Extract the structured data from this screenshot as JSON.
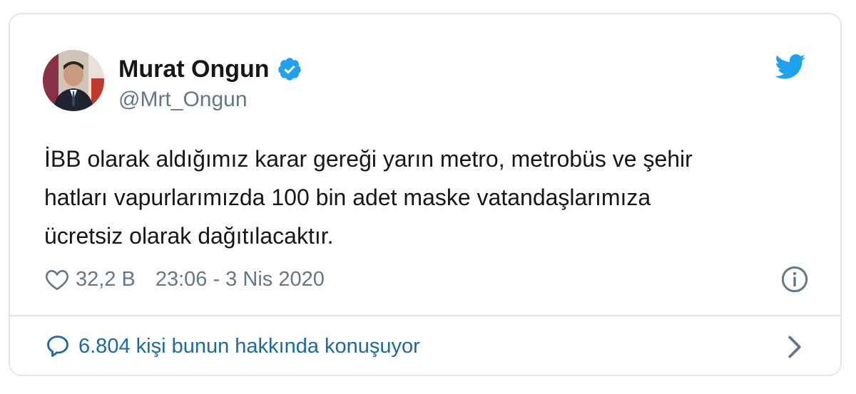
{
  "user": {
    "name": "Murat Ongun",
    "handle": "@Mrt_Ongun",
    "verified": true
  },
  "tweet": {
    "lines": [
      "İBB olarak aldığımız karar gereği yarın metro, metrobüs ve şehir",
      "hatları vapurlarımızda 100 bin adet maske vatandaşlarımıza",
      "ücretsiz olarak dağıtılacaktır."
    ]
  },
  "meta": {
    "likes": "32,2 B",
    "timestamp": "23:06 - 3 Nis 2020"
  },
  "footer": {
    "conversation_text": "6.804 kişi bunun hakkında konuşuyor"
  },
  "icons": {
    "brand": "twitter-bird-icon",
    "verified": "verified-badge-icon",
    "like": "heart-icon",
    "info": "info-icon",
    "reply": "reply-bubble-icon",
    "chevron": "chevron-right-icon"
  },
  "colors": {
    "twitter_blue": "#1da1f2",
    "link_blue": "#1b6aa5",
    "text": "#14171a",
    "secondary": "#657786",
    "border": "#e1e8ed"
  }
}
